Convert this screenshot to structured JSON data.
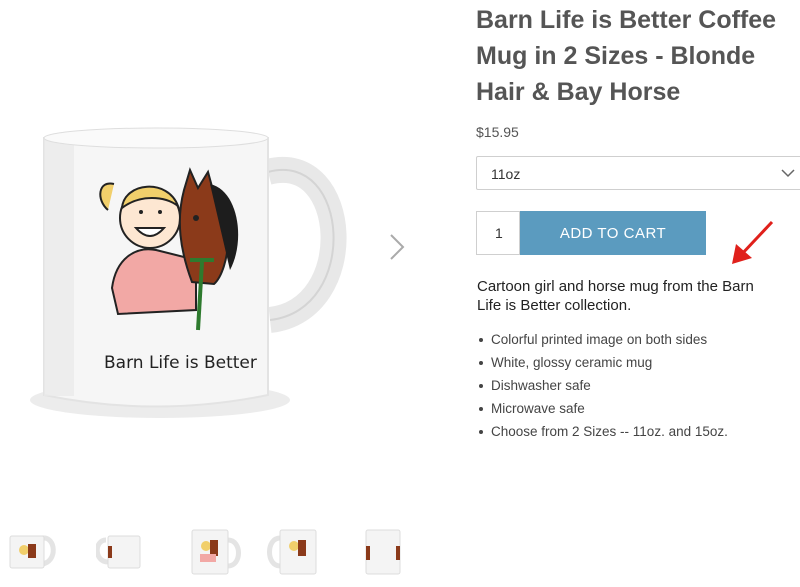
{
  "product": {
    "title": "Barn Life is Better Coffee Mug in 2 Sizes - Blonde Hair & Bay Horse",
    "price": "$15.95",
    "size_select": {
      "selected": "11oz"
    },
    "quantity": "1",
    "add_to_cart_label": "ADD TO CART",
    "description": "Cartoon girl and horse mug from the Barn Life is Better collection.",
    "bullets": [
      "Colorful printed image on both sides",
      "White, glossy ceramic mug",
      "Dishwasher safe",
      "Microwave safe",
      "Choose from  2 Sizes -- 11oz. and 15oz."
    ]
  },
  "mug_print_text": "Barn Life is Better",
  "icons": {
    "next": "chevron-right-icon",
    "dropdown": "chevron-down-icon",
    "annotation": "red-arrow-icon"
  },
  "colors": {
    "button": "#5b9bbf",
    "annotation_arrow": "#e0201b",
    "title": "#555555"
  }
}
